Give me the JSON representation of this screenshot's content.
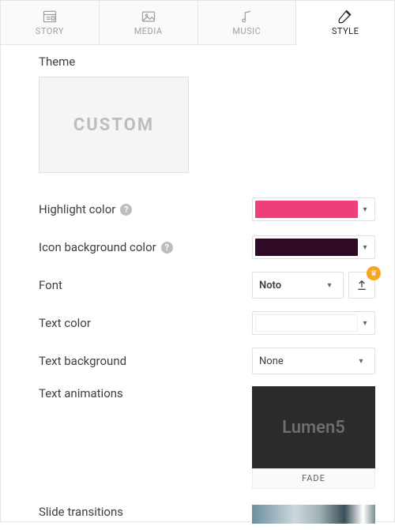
{
  "tabs": {
    "story": "STORY",
    "media": "MEDIA",
    "music": "MUSIC",
    "style": "STYLE"
  },
  "theme": {
    "label": "Theme",
    "card_text": "CUSTOM"
  },
  "rows": {
    "highlight_color": {
      "label": "Highlight color",
      "value": "#ef3f7a"
    },
    "icon_bg_color": {
      "label": "Icon background color",
      "value": "#2e0a26"
    },
    "font": {
      "label": "Font",
      "value": "Noto"
    },
    "text_color": {
      "label": "Text color",
      "value": "#ffffff"
    },
    "text_background": {
      "label": "Text background",
      "value": "None"
    },
    "text_animations": {
      "label": "Text animations",
      "preview_text": "Lumen5",
      "name": "FADE"
    },
    "slide_transitions": {
      "label": "Slide transitions"
    }
  },
  "help_glyph": "?"
}
